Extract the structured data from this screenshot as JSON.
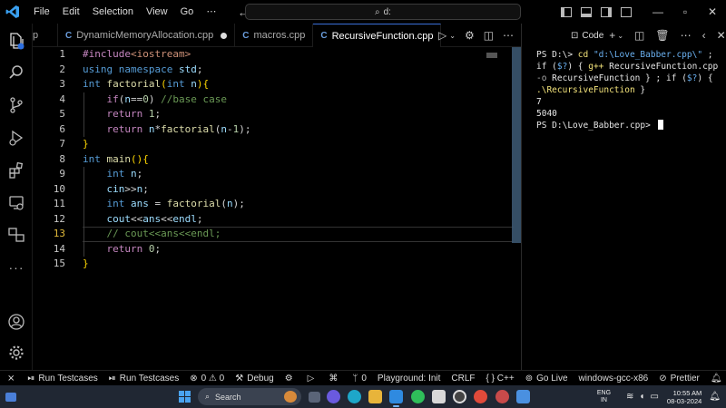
{
  "menu": {
    "items": [
      "File",
      "Edit",
      "Selection",
      "View",
      "Go",
      "⋯"
    ]
  },
  "command_center": {
    "text": "d:"
  },
  "tabs": [
    {
      "label": "p",
      "icon": "",
      "modified": false,
      "active": false
    },
    {
      "label": "DynamicMemoryAllocation.cpp",
      "icon": "C",
      "modified": true,
      "active": false
    },
    {
      "label": "macros.cpp",
      "icon": "C",
      "modified": false,
      "active": false
    },
    {
      "label": "RecursiveFunction.cpp",
      "icon": "C",
      "modified": false,
      "active": true
    }
  ],
  "editor": {
    "current_line": 13,
    "lines": [
      {
        "n": "1",
        "tokens": [
          [
            "k-pre",
            "#include"
          ],
          [
            "k-inc",
            "<iostream>"
          ]
        ]
      },
      {
        "n": "2",
        "tokens": [
          [
            "k-blue",
            "using"
          ],
          [
            "k-txt",
            " "
          ],
          [
            "k-blue",
            "namespace"
          ],
          [
            "k-txt",
            " "
          ],
          [
            "k-var",
            "std"
          ],
          [
            "k-txt",
            ";"
          ]
        ]
      },
      {
        "n": "3",
        "tokens": [
          [
            "k-blue",
            "int"
          ],
          [
            "k-txt",
            " "
          ],
          [
            "k-fn",
            "factorial"
          ],
          [
            "k-brace",
            "("
          ],
          [
            "k-blue",
            "int"
          ],
          [
            "k-txt",
            " "
          ],
          [
            "k-var",
            "n"
          ],
          [
            "k-brace",
            ")"
          ],
          [
            "k-brace",
            "{"
          ]
        ]
      },
      {
        "n": "4",
        "tokens": [
          [
            "k-txt",
            "    "
          ],
          [
            "k-ctl",
            "if"
          ],
          [
            "k-txt",
            "("
          ],
          [
            "k-var",
            "n"
          ],
          [
            "k-txt",
            "=="
          ],
          [
            "k-num",
            "0"
          ],
          [
            "k-txt",
            ") "
          ],
          [
            "k-com",
            "//base case"
          ]
        ]
      },
      {
        "n": "5",
        "tokens": [
          [
            "k-txt",
            "    "
          ],
          [
            "k-ctl",
            "return"
          ],
          [
            "k-txt",
            " "
          ],
          [
            "k-num",
            "1"
          ],
          [
            "k-txt",
            ";"
          ]
        ]
      },
      {
        "n": "6",
        "tokens": [
          [
            "k-txt",
            "    "
          ],
          [
            "k-ctl",
            "return"
          ],
          [
            "k-txt",
            " "
          ],
          [
            "k-var",
            "n"
          ],
          [
            "k-txt",
            "*"
          ],
          [
            "k-fn",
            "factorial"
          ],
          [
            "k-txt",
            "("
          ],
          [
            "k-var",
            "n"
          ],
          [
            "k-txt",
            "-"
          ],
          [
            "k-num",
            "1"
          ],
          [
            "k-txt",
            ");"
          ]
        ]
      },
      {
        "n": "7",
        "tokens": [
          [
            "k-brace",
            "}"
          ]
        ]
      },
      {
        "n": "8",
        "tokens": [
          [
            "k-blue",
            "int"
          ],
          [
            "k-txt",
            " "
          ],
          [
            "k-fn",
            "main"
          ],
          [
            "k-brace",
            "()"
          ],
          [
            "k-brace",
            "{"
          ]
        ]
      },
      {
        "n": "9",
        "tokens": [
          [
            "k-txt",
            "    "
          ],
          [
            "k-blue",
            "int"
          ],
          [
            "k-txt",
            " "
          ],
          [
            "k-var",
            "n"
          ],
          [
            "k-txt",
            ";"
          ]
        ]
      },
      {
        "n": "10",
        "tokens": [
          [
            "k-txt",
            "    "
          ],
          [
            "k-var",
            "cin"
          ],
          [
            "k-txt",
            ">>"
          ],
          [
            "k-var",
            "n"
          ],
          [
            "k-txt",
            ";"
          ]
        ]
      },
      {
        "n": "11",
        "tokens": [
          [
            "k-txt",
            "    "
          ],
          [
            "k-blue",
            "int"
          ],
          [
            "k-txt",
            " "
          ],
          [
            "k-var",
            "ans"
          ],
          [
            "k-txt",
            " = "
          ],
          [
            "k-fn",
            "factorial"
          ],
          [
            "k-txt",
            "("
          ],
          [
            "k-var",
            "n"
          ],
          [
            "k-txt",
            ");"
          ]
        ]
      },
      {
        "n": "12",
        "tokens": [
          [
            "k-txt",
            "    "
          ],
          [
            "k-var",
            "cout"
          ],
          [
            "k-txt",
            "<<"
          ],
          [
            "k-var",
            "ans"
          ],
          [
            "k-txt",
            "<<"
          ],
          [
            "k-var",
            "endl"
          ],
          [
            "k-txt",
            ";"
          ]
        ]
      },
      {
        "n": "13",
        "tokens": [
          [
            "k-txt",
            "    "
          ],
          [
            "k-com",
            "// cout<<ans<<endl;"
          ]
        ]
      },
      {
        "n": "14",
        "tokens": [
          [
            "k-txt",
            "    "
          ],
          [
            "k-ctl",
            "return"
          ],
          [
            "k-txt",
            " "
          ],
          [
            "k-num",
            "0"
          ],
          [
            "k-txt",
            ";"
          ]
        ]
      },
      {
        "n": "15",
        "tokens": [
          [
            "k-brace",
            "}"
          ]
        ]
      }
    ]
  },
  "panel": {
    "title": "Code"
  },
  "terminal": {
    "prompt1": "PS D:\\> ",
    "cmd_cd": "cd ",
    "path_str": "\"d:\\Love_Babber.cpp\\\"",
    "rest1": " ; if (",
    "var1": "$?",
    "rest2": ") { ",
    "cmd_gpp": "g++",
    "rest3": " RecursiveFunction.cpp ",
    "flag": "-o",
    "rest4": " RecursiveFunction } ; ",
    "kw_if": "if",
    "rest5": " (",
    "var2": "$?",
    "rest6": ") { ",
    "exe": ".\\RecursiveFunction",
    "rest7": " }",
    "input": "7",
    "output": "5040",
    "prompt2": "PS D:\\Love_Babber.cpp> "
  },
  "statusbar": {
    "left": [
      {
        "icon": "⏯",
        "label": "Run Testcases"
      },
      {
        "icon": "⏯",
        "label": "Run Testcases"
      },
      {
        "icon": "⊗",
        "label": "0 ⚠ 0"
      },
      {
        "icon": "⚒",
        "label": "Debug"
      },
      {
        "icon": "⚙",
        "label": ""
      },
      {
        "icon": "▷",
        "label": ""
      },
      {
        "icon": "⌘",
        "label": ""
      },
      {
        "icon": "ᛘ",
        "label": "0"
      },
      {
        "icon": "",
        "label": "Playground: Init"
      }
    ],
    "right": [
      {
        "icon": "",
        "label": "CRLF"
      },
      {
        "icon": "",
        "label": "{ } C++"
      },
      {
        "icon": "⊚",
        "label": "Go Live"
      },
      {
        "icon": "",
        "label": "windows-gcc-x86"
      },
      {
        "icon": "⊘",
        "label": "Prettier"
      },
      {
        "icon": "🔔",
        "label": ""
      }
    ]
  },
  "taskbar": {
    "search_label": "Search",
    "lang_top": "ENG",
    "lang_bottom": "IN",
    "time": "10:55 AM",
    "date": "08-03-2024"
  },
  "colors": {
    "accent": "#3a6fd8",
    "scrollbar": "#3b5770",
    "taskbar": "#202733"
  }
}
